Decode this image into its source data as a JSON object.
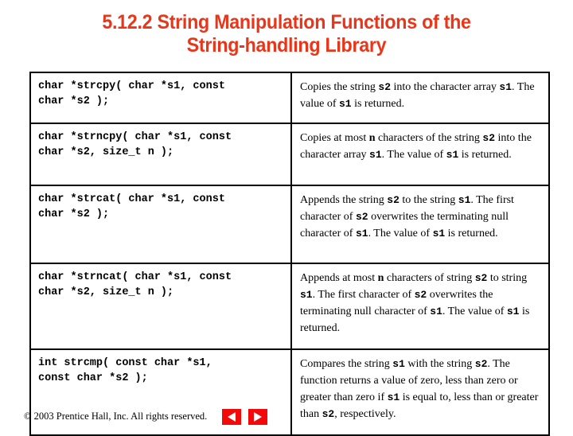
{
  "slide": {
    "title_line1": "5.12.2 String Manipulation Functions of the",
    "title_line2": "String-handling Library",
    "title_color": "#E8361A"
  },
  "table": {
    "rows": [
      {
        "prototype": "char *strcpy( char *s1, const\nchar *s2 );",
        "description_parts": [
          {
            "text": "Copies the string ",
            "style": "plain"
          },
          {
            "text": "s2",
            "style": "code"
          },
          {
            "text": " into the character array ",
            "style": "plain"
          },
          {
            "text": "s1",
            "style": "code"
          },
          {
            "text": ". The value of ",
            "style": "plain"
          },
          {
            "text": "s1",
            "style": "code"
          },
          {
            "text": " is returned.",
            "style": "plain"
          }
        ]
      },
      {
        "prototype": "char *strncpy( char *s1, const\nchar *s2, size_t n );",
        "description_parts": [
          {
            "text": "Copies at most ",
            "style": "plain"
          },
          {
            "text": "n",
            "style": "em"
          },
          {
            "text": " characters of the string ",
            "style": "plain"
          },
          {
            "text": "s2",
            "style": "code"
          },
          {
            "text": " into the character array ",
            "style": "plain"
          },
          {
            "text": "s1",
            "style": "code"
          },
          {
            "text": ". The value of ",
            "style": "plain"
          },
          {
            "text": "s1",
            "style": "code"
          },
          {
            "text": " is returned.",
            "style": "plain"
          }
        ]
      },
      {
        "prototype": "char *strcat( char *s1, const\nchar *s2 );",
        "description_parts": [
          {
            "text": "Appends the string ",
            "style": "plain"
          },
          {
            "text": "s2",
            "style": "code"
          },
          {
            "text": " to the string ",
            "style": "plain"
          },
          {
            "text": "s1",
            "style": "code"
          },
          {
            "text": ". The first character of ",
            "style": "plain"
          },
          {
            "text": "s2",
            "style": "code"
          },
          {
            "text": " overwrites the terminating null character of ",
            "style": "plain"
          },
          {
            "text": "s1",
            "style": "code"
          },
          {
            "text": ". The value of ",
            "style": "plain"
          },
          {
            "text": "s1",
            "style": "code"
          },
          {
            "text": " is returned.",
            "style": "plain"
          }
        ]
      },
      {
        "prototype": "char *strncat( char *s1, const\nchar *s2, size_t n );",
        "description_parts": [
          {
            "text": "Appends at most ",
            "style": "plain"
          },
          {
            "text": "n",
            "style": "em"
          },
          {
            "text": " characters of string ",
            "style": "plain"
          },
          {
            "text": "s2",
            "style": "code"
          },
          {
            "text": " to string ",
            "style": "plain"
          },
          {
            "text": "s1",
            "style": "code"
          },
          {
            "text": ". The first character of ",
            "style": "plain"
          },
          {
            "text": "s2",
            "style": "code"
          },
          {
            "text": " overwrites the terminating null character of ",
            "style": "plain"
          },
          {
            "text": "s1",
            "style": "code"
          },
          {
            "text": ". The value of ",
            "style": "plain"
          },
          {
            "text": "s1",
            "style": "code"
          },
          {
            "text": " is returned.",
            "style": "plain"
          }
        ]
      },
      {
        "prototype": "int strcmp( const char *s1,\nconst char *s2 );",
        "description_parts": [
          {
            "text": "Compares the string ",
            "style": "plain"
          },
          {
            "text": "s1",
            "style": "code"
          },
          {
            "text": " with the string ",
            "style": "plain"
          },
          {
            "text": "s2",
            "style": "code"
          },
          {
            "text": ". The function returns a value of zero, less than zero or greater than zero if ",
            "style": "plain"
          },
          {
            "text": "s1",
            "style": "code"
          },
          {
            "text": " is equal to, less than or greater than ",
            "style": "plain"
          },
          {
            "text": "s2",
            "style": "code"
          },
          {
            "text": ", respectively.",
            "style": "plain"
          }
        ]
      }
    ]
  },
  "footer": {
    "copyright": "© 2003 Prentice Hall, Inc.  All rights reserved.",
    "prev_icon": "triangle-left-icon",
    "next_icon": "triangle-right-icon",
    "button_color": "#F20A0A"
  }
}
